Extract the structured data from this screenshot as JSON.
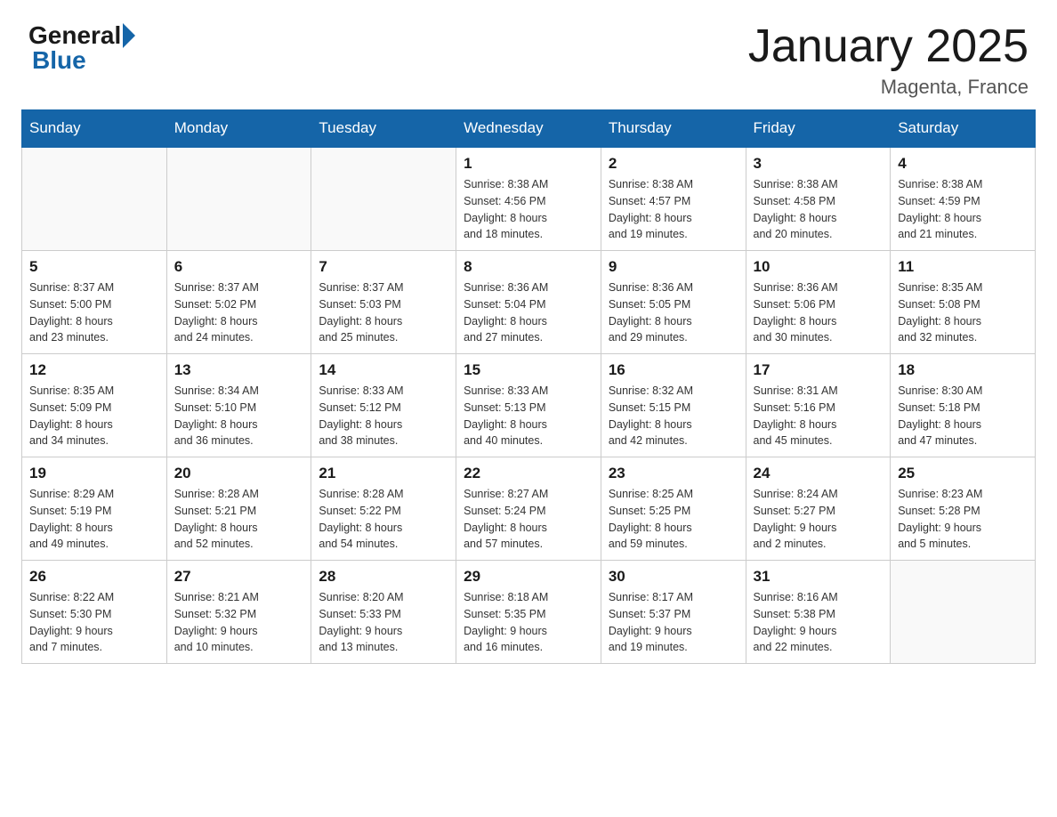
{
  "logo": {
    "general": "General",
    "blue": "Blue"
  },
  "title": "January 2025",
  "subtitle": "Magenta, France",
  "days_of_week": [
    "Sunday",
    "Monday",
    "Tuesday",
    "Wednesday",
    "Thursday",
    "Friday",
    "Saturday"
  ],
  "weeks": [
    [
      {
        "day": "",
        "info": ""
      },
      {
        "day": "",
        "info": ""
      },
      {
        "day": "",
        "info": ""
      },
      {
        "day": "1",
        "info": "Sunrise: 8:38 AM\nSunset: 4:56 PM\nDaylight: 8 hours\nand 18 minutes."
      },
      {
        "day": "2",
        "info": "Sunrise: 8:38 AM\nSunset: 4:57 PM\nDaylight: 8 hours\nand 19 minutes."
      },
      {
        "day": "3",
        "info": "Sunrise: 8:38 AM\nSunset: 4:58 PM\nDaylight: 8 hours\nand 20 minutes."
      },
      {
        "day": "4",
        "info": "Sunrise: 8:38 AM\nSunset: 4:59 PM\nDaylight: 8 hours\nand 21 minutes."
      }
    ],
    [
      {
        "day": "5",
        "info": "Sunrise: 8:37 AM\nSunset: 5:00 PM\nDaylight: 8 hours\nand 23 minutes."
      },
      {
        "day": "6",
        "info": "Sunrise: 8:37 AM\nSunset: 5:02 PM\nDaylight: 8 hours\nand 24 minutes."
      },
      {
        "day": "7",
        "info": "Sunrise: 8:37 AM\nSunset: 5:03 PM\nDaylight: 8 hours\nand 25 minutes."
      },
      {
        "day": "8",
        "info": "Sunrise: 8:36 AM\nSunset: 5:04 PM\nDaylight: 8 hours\nand 27 minutes."
      },
      {
        "day": "9",
        "info": "Sunrise: 8:36 AM\nSunset: 5:05 PM\nDaylight: 8 hours\nand 29 minutes."
      },
      {
        "day": "10",
        "info": "Sunrise: 8:36 AM\nSunset: 5:06 PM\nDaylight: 8 hours\nand 30 minutes."
      },
      {
        "day": "11",
        "info": "Sunrise: 8:35 AM\nSunset: 5:08 PM\nDaylight: 8 hours\nand 32 minutes."
      }
    ],
    [
      {
        "day": "12",
        "info": "Sunrise: 8:35 AM\nSunset: 5:09 PM\nDaylight: 8 hours\nand 34 minutes."
      },
      {
        "day": "13",
        "info": "Sunrise: 8:34 AM\nSunset: 5:10 PM\nDaylight: 8 hours\nand 36 minutes."
      },
      {
        "day": "14",
        "info": "Sunrise: 8:33 AM\nSunset: 5:12 PM\nDaylight: 8 hours\nand 38 minutes."
      },
      {
        "day": "15",
        "info": "Sunrise: 8:33 AM\nSunset: 5:13 PM\nDaylight: 8 hours\nand 40 minutes."
      },
      {
        "day": "16",
        "info": "Sunrise: 8:32 AM\nSunset: 5:15 PM\nDaylight: 8 hours\nand 42 minutes."
      },
      {
        "day": "17",
        "info": "Sunrise: 8:31 AM\nSunset: 5:16 PM\nDaylight: 8 hours\nand 45 minutes."
      },
      {
        "day": "18",
        "info": "Sunrise: 8:30 AM\nSunset: 5:18 PM\nDaylight: 8 hours\nand 47 minutes."
      }
    ],
    [
      {
        "day": "19",
        "info": "Sunrise: 8:29 AM\nSunset: 5:19 PM\nDaylight: 8 hours\nand 49 minutes."
      },
      {
        "day": "20",
        "info": "Sunrise: 8:28 AM\nSunset: 5:21 PM\nDaylight: 8 hours\nand 52 minutes."
      },
      {
        "day": "21",
        "info": "Sunrise: 8:28 AM\nSunset: 5:22 PM\nDaylight: 8 hours\nand 54 minutes."
      },
      {
        "day": "22",
        "info": "Sunrise: 8:27 AM\nSunset: 5:24 PM\nDaylight: 8 hours\nand 57 minutes."
      },
      {
        "day": "23",
        "info": "Sunrise: 8:25 AM\nSunset: 5:25 PM\nDaylight: 8 hours\nand 59 minutes."
      },
      {
        "day": "24",
        "info": "Sunrise: 8:24 AM\nSunset: 5:27 PM\nDaylight: 9 hours\nand 2 minutes."
      },
      {
        "day": "25",
        "info": "Sunrise: 8:23 AM\nSunset: 5:28 PM\nDaylight: 9 hours\nand 5 minutes."
      }
    ],
    [
      {
        "day": "26",
        "info": "Sunrise: 8:22 AM\nSunset: 5:30 PM\nDaylight: 9 hours\nand 7 minutes."
      },
      {
        "day": "27",
        "info": "Sunrise: 8:21 AM\nSunset: 5:32 PM\nDaylight: 9 hours\nand 10 minutes."
      },
      {
        "day": "28",
        "info": "Sunrise: 8:20 AM\nSunset: 5:33 PM\nDaylight: 9 hours\nand 13 minutes."
      },
      {
        "day": "29",
        "info": "Sunrise: 8:18 AM\nSunset: 5:35 PM\nDaylight: 9 hours\nand 16 minutes."
      },
      {
        "day": "30",
        "info": "Sunrise: 8:17 AM\nSunset: 5:37 PM\nDaylight: 9 hours\nand 19 minutes."
      },
      {
        "day": "31",
        "info": "Sunrise: 8:16 AM\nSunset: 5:38 PM\nDaylight: 9 hours\nand 22 minutes."
      },
      {
        "day": "",
        "info": ""
      }
    ]
  ]
}
